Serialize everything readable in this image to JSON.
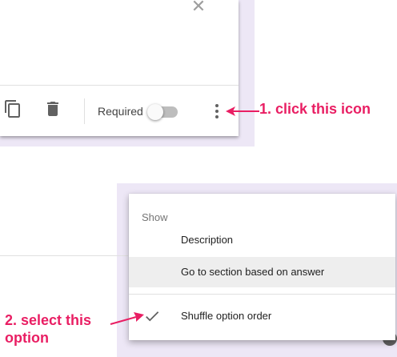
{
  "card": {
    "close_glyph": "✕",
    "required_label": "Required",
    "toggle_on": false
  },
  "annotations": {
    "step1": "1. click this icon",
    "step2_line1": "2. select this",
    "step2_line2": "option",
    "color": "#e91e63"
  },
  "menu": {
    "header": "Show",
    "items": [
      {
        "label": "Description",
        "checked": false,
        "highlighted": false
      },
      {
        "label": "Go to section based on answer",
        "checked": false,
        "highlighted": true
      },
      {
        "label": "Shuffle option order",
        "checked": true,
        "highlighted": false
      }
    ]
  },
  "colors": {
    "lavender": "#ede7f6",
    "accent_pink": "#e91e63",
    "icon_gray": "#616161"
  }
}
